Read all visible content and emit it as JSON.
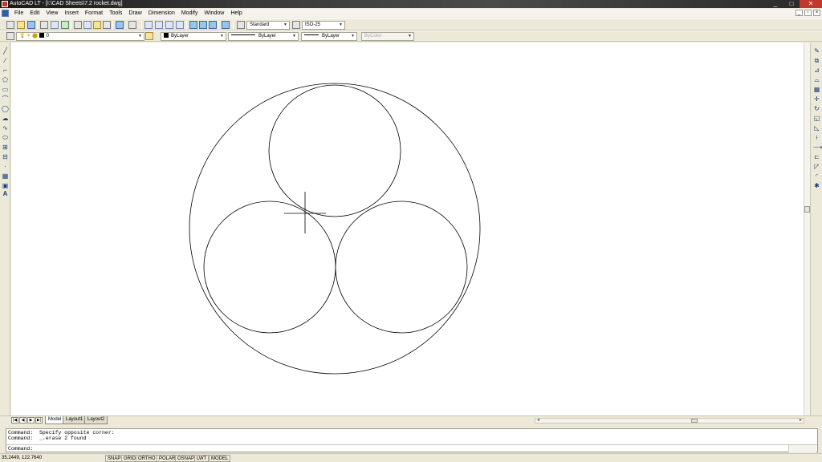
{
  "window": {
    "title": "AutoCAD LT - [I:\\CAD Sheets\\7.2 rocket.dwg]"
  },
  "menu": [
    "File",
    "Edit",
    "View",
    "Insert",
    "Format",
    "Tools",
    "Draw",
    "Dimension",
    "Modify",
    "Window",
    "Help"
  ],
  "styles": {
    "text_style": "Standard",
    "dim_style": "ISO-25"
  },
  "properties": {
    "layer": "0",
    "color": "ByLayer",
    "linetype": "ByLayer",
    "lineweight": "ByLayer",
    "plot_style": "ByColor"
  },
  "tabs": [
    {
      "label": "Model",
      "active": true
    },
    {
      "label": "Layout1",
      "active": false
    },
    {
      "label": "Layout2",
      "active": false
    }
  ],
  "command": {
    "history": [
      "Command:  Specify opposite corner:",
      "Command:  _.erase 2 found"
    ],
    "prompt": "Command:"
  },
  "status": {
    "coords": "35.2449, 122.7640",
    "toggles": [
      "SNAP",
      "GRID",
      "ORTHO",
      "POLAR",
      "OSNAP",
      "LWT",
      "MODEL"
    ]
  },
  "colors": {
    "title_bar": "#2a2a2a",
    "canvas": "#ffffff",
    "chrome": "#ece9d8",
    "close_button": "#c0392b"
  }
}
